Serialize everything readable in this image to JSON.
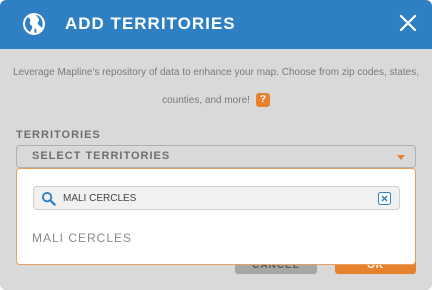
{
  "header": {
    "title": "ADD TERRITORIES",
    "icon": "globe-icon",
    "close_icon": "close-icon",
    "color": "#2f7fc3"
  },
  "description": {
    "text": "Leverage Mapline's repository of data to enhance your map. Choose from zip codes, states, counties, and more!",
    "help_label": "?"
  },
  "territories": {
    "label": "TERRITORIES",
    "select_placeholder": "SELECT TERRITORIES"
  },
  "dropdown": {
    "search_value": "MALI CERCLES",
    "options": [
      "MALI CERCLES"
    ]
  },
  "buttons": {
    "cancel_label": "CANCEL",
    "ok_label": "OK"
  },
  "colors": {
    "accent": "#e8812c",
    "header": "#2f7fc3"
  }
}
